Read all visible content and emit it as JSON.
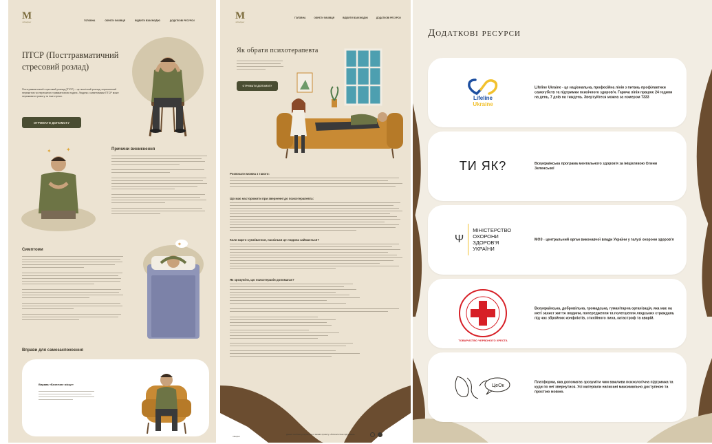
{
  "panel1": {
    "logo": {
      "mark": "M",
      "sub": "mhelper"
    },
    "nav": [
      "ГОЛОВНА",
      "ОБРАТИ ФАХІВЦЯ",
      "ВІДБИТИ ВЗАЄМОДІЮ",
      "ДОДАТКОВІ РЕСУРСИ"
    ],
    "title": "ПТСР (Посттравматичний стресовий розлад)",
    "intro": "Посттравматичний стресовий розлад (ПТСР) – це психічний розлад, спричинений пережитою чи пережитою травматичною подією. Людина з симптомами ПТСР може переживати тривогу та інші стреси.",
    "help_button": "ОТРИМАТИ ДОПОМОГУ",
    "causes_heading": "Причини виникнення",
    "symptoms_heading": "Симптоми",
    "exercises_heading": "Вправи для самозаспокоєння",
    "exercise_card_title": "Вправа «Безпечне місце»"
  },
  "panel2": {
    "logo": {
      "mark": "M",
      "sub": "mhelper"
    },
    "nav": [
      "ГОЛОВНА",
      "ОБРАТИ ФАХІВЦЯ",
      "ВІДБИТИ ВЗАЄМОДІЮ",
      "ДОДАТКОВІ РЕСУРСИ"
    ],
    "title": "Як обрати психотерапевта",
    "help_button": "ОТРИМАТИ ДОПОМОГУ",
    "sections": [
      "Розпочати можна з такого:",
      "Що має насторожити при зверненні до психотерапевта:",
      "Коли варто сумніватися, наскільки це людина займається?",
      "Як зрозуміти, що психотерапія допомагає?"
    ],
    "footer_left": "mhelper",
    "footer_mid": "Даний посібник розроблено в межах проєкту «Психологічна підтримка»"
  },
  "panel3": {
    "title": "Додаткові ресурси",
    "resources": [
      {
        "logo_line1": "Lifeline",
        "logo_line2": "Ukraine",
        "text": "Lifeline Ukraine - це національна, професійна лінія з питань профілактики самогубств та підтримки психічного здоров'я. Гаряча лінія працює 24 години на день, 7 днів на тиждень. Звертуйтеся можна за номером 7333"
      },
      {
        "logo_text": "ТИ ЯК?",
        "text": "Всеукраїнська програма ментального здоров'я за ініціативою Олени Зеленської"
      },
      {
        "logo_lines": [
          "МІНІСТЕРСТВО",
          "ОХОРОНИ",
          "ЗДОРОВ'Я",
          "УКРАЇНИ"
        ],
        "text": "МОЗ - центральний орган виконавчої влади України у галузі охорони здоров'я"
      },
      {
        "logo_ring": "ТОВАРИСТВО ЧЕРВОНОГО ХРЕСТА",
        "text": "Всеукраїнська, добровільна, громадська, гуманітарна організація, яка має на меті захист життя людини, попередження та полегшення людських страждань під час збройних конфліктів, стихійного лиха, катастроф та аварій."
      },
      {
        "logo_text": "ЦеОк",
        "text": "Платформа, яка допомагає зрозуміти чим важлива психологічна підтримка та куди по неї звернутися. Усі матеріали написані максимально доступною та простою мовою."
      }
    ]
  },
  "colors": {
    "panel_bg": "#ece3d2",
    "button": "#4a4d32",
    "lifeline_blue": "#1d4fa0",
    "lifeline_yellow": "#f2c12e",
    "red_cross": "#d71f26"
  }
}
